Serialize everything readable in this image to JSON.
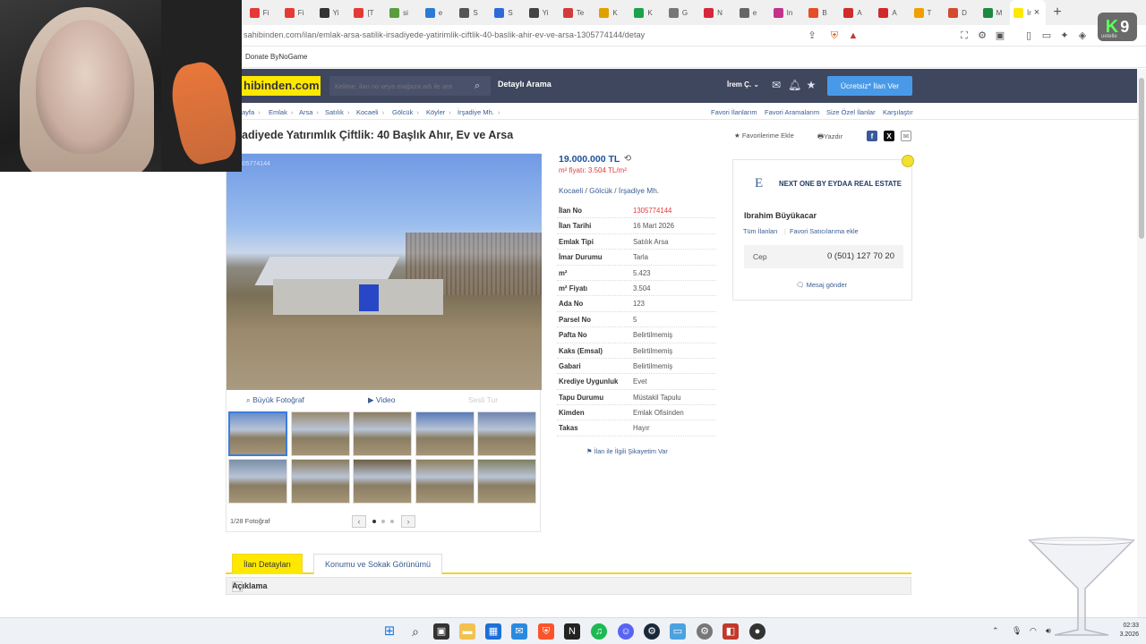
{
  "browser": {
    "url": "sahibinden.com/ilan/emlak-arsa-satilik-irsadiyede-yatirimlik-ciftlik-40-baslik-ahir-ev-ve-arsa-1305774144/detay",
    "bookmark": "Donate ByNoGame",
    "active_tab": "İr",
    "tab_labels": [
      "Fi",
      "Fi",
      "Yi",
      "[T",
      "si",
      "e",
      "S",
      "S",
      "Yi",
      "Te",
      "K",
      "K",
      "G",
      "N",
      "e",
      "In",
      "B",
      "A",
      "A",
      "T",
      "D",
      "M"
    ],
    "tab_colors": [
      "#e53935",
      "#e53935",
      "#333333",
      "#e53935",
      "#5a9e3e",
      "#2b7bd6",
      "#555555",
      "#2f6bd8",
      "#444444",
      "#d23b3b",
      "#e0a000",
      "#1aa34a",
      "#777777",
      "#d6263a",
      "#666666",
      "#c4328a",
      "#e44d26",
      "#d12a2a",
      "#d12a2a",
      "#f0a000",
      "#d24b2f",
      "#1b8a3d"
    ],
    "badge": {
      "k": "K",
      "n": "9",
      "sub": "uetelle"
    }
  },
  "header": {
    "logo": "hibinden.com",
    "search_placeholder": "Kelime, ilan no veya mağaza adı ile ara",
    "detailed_search": "Detaylı Arama",
    "user": "İrem Ç.",
    "post_button": "Ücretsiz* İlan Ver"
  },
  "breadcrumb": [
    "ayfa",
    "Emlak",
    "Arsa",
    "Satılık",
    "Kocaeli",
    "Gölcük",
    "Köyler",
    "İrşadiye Mh."
  ],
  "top_links": [
    "Favori İlanlarım",
    "Favori Aramalarım",
    "Size Özel İlanlar",
    "Karşılaştır"
  ],
  "listing": {
    "title": "adiyede Yatırımlık Çiftlik: 40 Başlık Ahır, Ev ve Arsa",
    "add_favorite": "Favorilerime Ekle",
    "print": "Yazdır",
    "photo_id": "1305774144",
    "price": "19.000.000 TL",
    "unit_price": "m² fiyatı: 3.504 TL/m²",
    "location": [
      "Kocaeli",
      "Gölcük",
      "İrşadiye Mh."
    ],
    "details": [
      {
        "key": "İlan No",
        "value": "1305774144",
        "red": true
      },
      {
        "key": "İlan Tarihi",
        "value": "16 Mart 2026"
      },
      {
        "key": "Emlak Tipi",
        "value": "Satılık Arsa"
      },
      {
        "key": "İmar Durumu",
        "value": "Tarla"
      },
      {
        "key": "m²",
        "value": "5.423"
      },
      {
        "key": "m² Fiyatı",
        "value": "3.504"
      },
      {
        "key": "Ada No",
        "value": "123"
      },
      {
        "key": "Parsel No",
        "value": "5"
      },
      {
        "key": "Pafta No",
        "value": "Belirtilmemiş"
      },
      {
        "key": "Kaks (Emsal)",
        "value": "Belirtilmemiş"
      },
      {
        "key": "Gabari",
        "value": "Belirtilmemiş"
      },
      {
        "key": "Krediye Uygunluk",
        "value": "Evet"
      },
      {
        "key": "Tapu Durumu",
        "value": "Müstakil Tapulu"
      },
      {
        "key": "Kimden",
        "value": "Emlak Ofisinden"
      },
      {
        "key": "Takas",
        "value": "Hayır"
      }
    ],
    "complaint": "İlan ile İlgili Şikayetim Var"
  },
  "gallery": {
    "big_photo": "Büyük Fotoğraf",
    "video": "Video",
    "third": "Sesli Tur",
    "counter": "1/28 Fotoğraf",
    "thumb_colors": [
      "#6c8fc9",
      "#9a8a6f",
      "#8c7c61",
      "#587bb8",
      "#6f86b2",
      "#7a8fa8",
      "#8a7a5c",
      "#6c5e44",
      "#8d7f5a",
      "#7f8060"
    ]
  },
  "seller": {
    "logo_letter": "E",
    "name": "NEXT ONE BY EYDAA REAL ESTATE",
    "person": "Ibrahim Büyükacar",
    "all_listings": "Tüm İlanları",
    "favorite_seller": "Favori Satıcılarıma ekle",
    "phone_label": "Cep",
    "phone": "0 (501) 127 70 20",
    "message": "Mesaj gönder"
  },
  "bottom_tabs": [
    "İlan Detayları",
    "Konumu ve Sokak Görünümü"
  ],
  "section": "Açıklama",
  "taskbar": {
    "time": "02:33",
    "date": "3.2026"
  }
}
